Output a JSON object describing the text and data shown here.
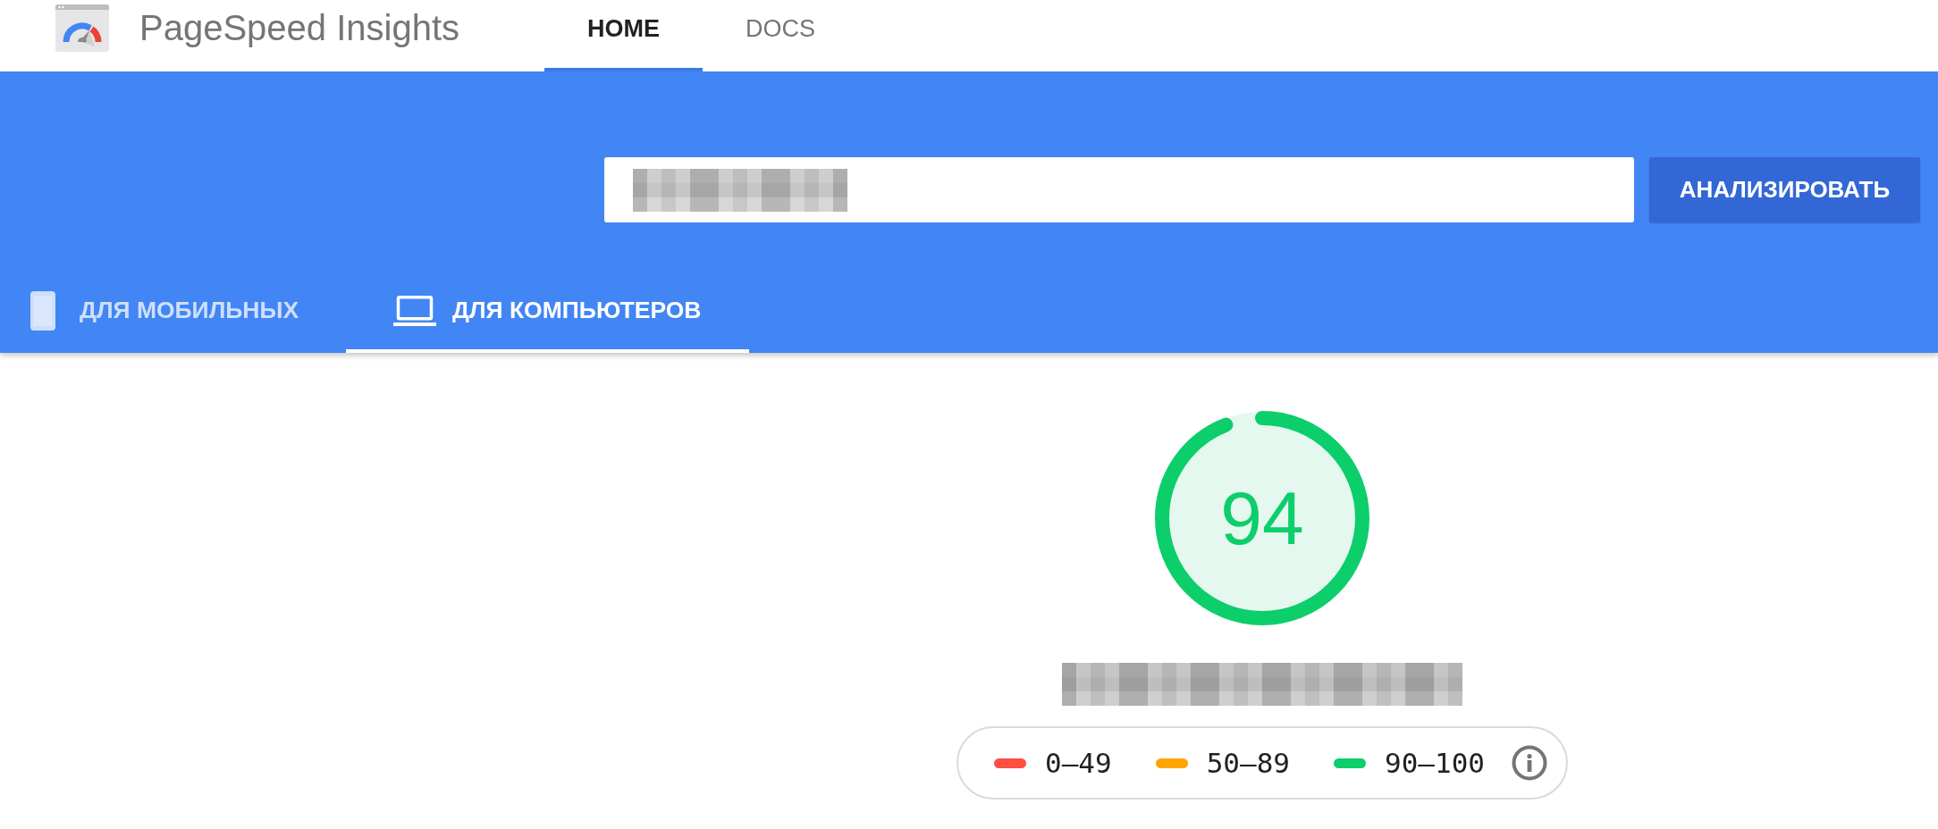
{
  "header": {
    "title": "PageSpeed Insights",
    "nav_tabs": [
      {
        "label": "HOME",
        "selected": true
      },
      {
        "label": "DOCS",
        "selected": false
      }
    ]
  },
  "search": {
    "button": "АНАЛИЗИРОВАТЬ"
  },
  "device_tabs": [
    {
      "kind": "mobile",
      "label": "ДЛЯ МОБИЛЬНЫХ",
      "selected": false
    },
    {
      "kind": "desktop",
      "label": "ДЛЯ КОМПЬЮТЕРОВ",
      "selected": true
    }
  ],
  "score": {
    "value": "94",
    "level": 0.94
  },
  "legend": [
    {
      "label": "0–49",
      "color": "#ff4e42"
    },
    {
      "label": "50–89",
      "color": "#ffa400"
    },
    {
      "label": "90–100",
      "color": "#0cce6b"
    }
  ]
}
